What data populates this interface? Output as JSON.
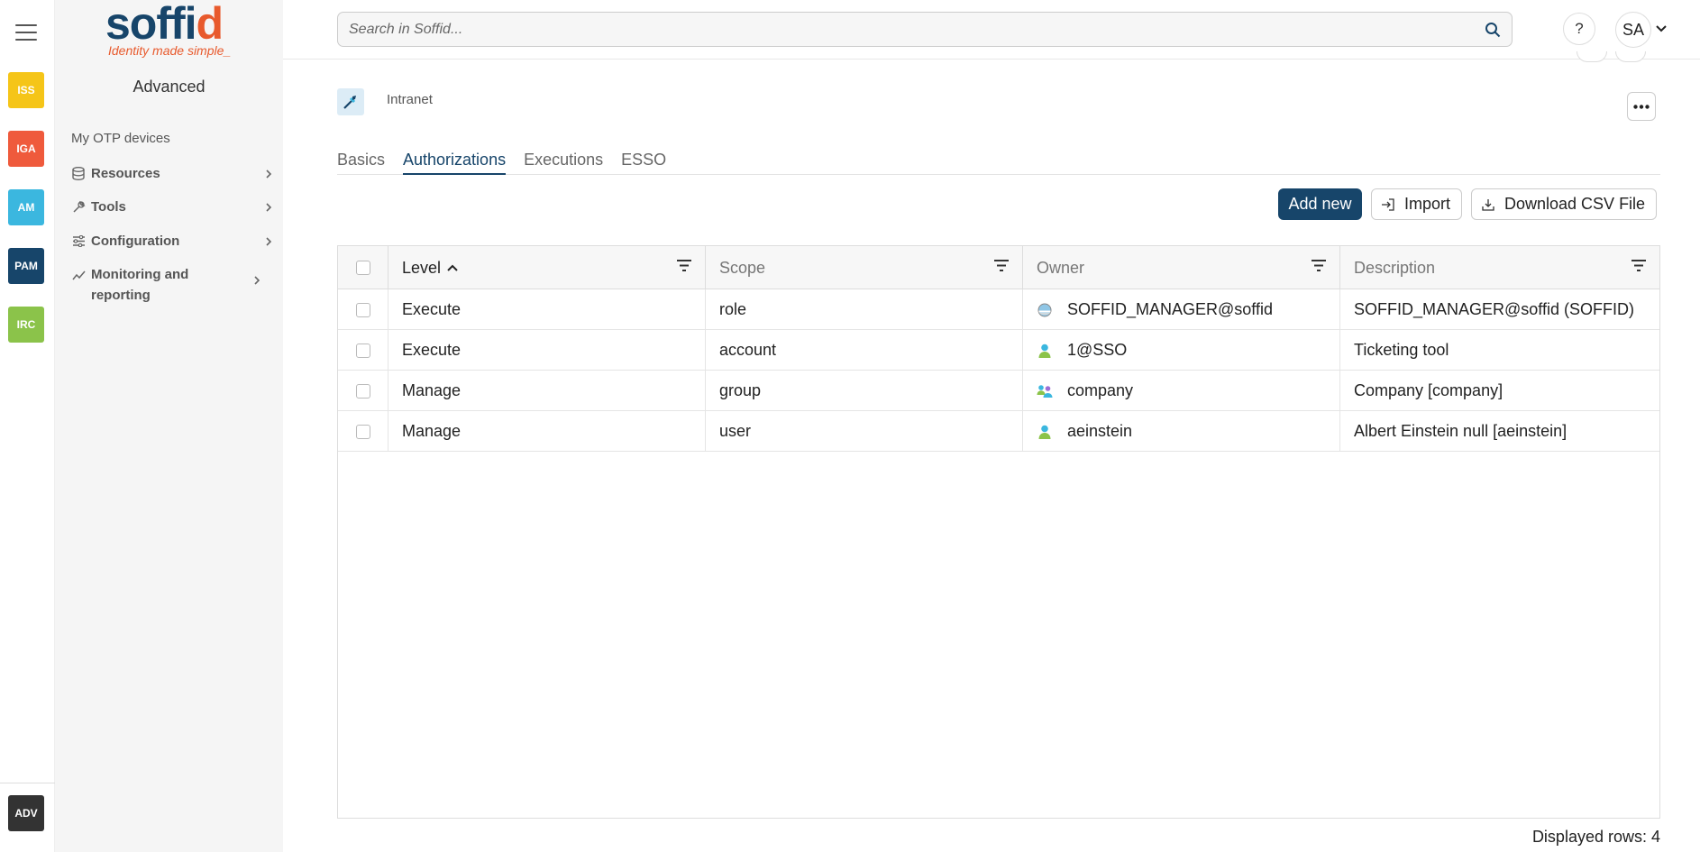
{
  "rail": {
    "apps": [
      {
        "label": "ISS",
        "color": "#f5c518",
        "text_color": "#ffffff"
      },
      {
        "label": "IGA",
        "color": "#ef5a3c"
      },
      {
        "label": "AM",
        "color": "#3bb7df"
      },
      {
        "label": "PAM",
        "color": "#17456a"
      },
      {
        "label": "IRC",
        "color": "#8bc34a"
      }
    ],
    "bottom_app": {
      "label": "ADV",
      "color": "#333333"
    }
  },
  "logo": {
    "word_main": "soffi",
    "word_accent": "d",
    "tagline": "Identity made simple_"
  },
  "sidebar": {
    "title": "Advanced",
    "link": "My OTP devices",
    "items": [
      {
        "label": "Resources",
        "icon": "database-icon"
      },
      {
        "label": "Tools",
        "icon": "wrench-icon"
      },
      {
        "label": "Configuration",
        "icon": "sliders-icon"
      },
      {
        "label": "Monitoring and reporting",
        "icon": "chart-line-icon"
      }
    ]
  },
  "search": {
    "placeholder": "Search in Soffid..."
  },
  "header": {
    "help": "?",
    "user_initials": "SA"
  },
  "page": {
    "breadcrumb": "Intranet"
  },
  "tabs": [
    "Basics",
    "Authorizations",
    "Executions",
    "ESSO"
  ],
  "active_tab": "Authorizations",
  "actions": {
    "add_new": "Add new",
    "import": "Import",
    "download": "Download CSV File"
  },
  "table": {
    "columns": [
      "Level",
      "Scope",
      "Owner",
      "Description"
    ],
    "sorted_column": "Level",
    "rows": [
      {
        "level": "Execute",
        "scope": "role",
        "owner": "SOFFID_MANAGER@soffid",
        "owner_icon": "role-icon",
        "description": "SOFFID_MANAGER@soffid (SOFFID)"
      },
      {
        "level": "Execute",
        "scope": "account",
        "owner": "1@SSO",
        "owner_icon": "user-icon",
        "description": "Ticketing tool"
      },
      {
        "level": "Manage",
        "scope": "group",
        "owner": "company",
        "owner_icon": "group-icon",
        "description": "Company [company]"
      },
      {
        "level": "Manage",
        "scope": "user",
        "owner": "aeinstein",
        "owner_icon": "user-icon",
        "description": "Albert Einstein null [aeinstein]"
      }
    ],
    "footer": "Displayed rows: 4"
  },
  "colors": {
    "brand": "#17456a",
    "accent": "#e85a2d"
  }
}
